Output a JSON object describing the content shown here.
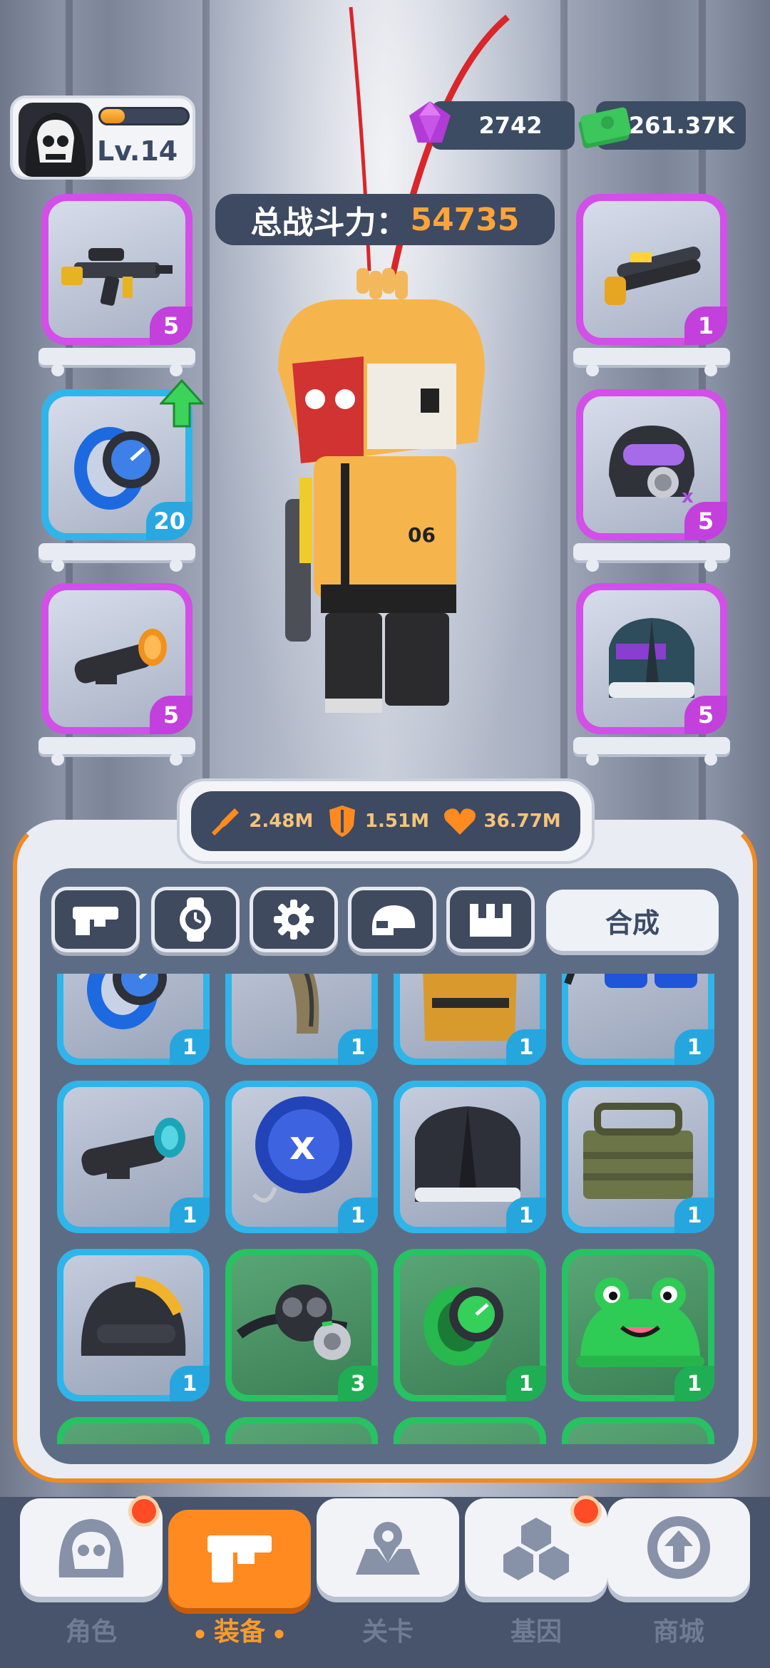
{
  "player": {
    "level_label": "Lv.14",
    "xp_fraction": 0.28,
    "avatar_icon": "skull-hood-icon"
  },
  "currency": {
    "gems": "2742",
    "cash": "261.37K"
  },
  "power": {
    "label": "总战斗力：",
    "value": "54735"
  },
  "equipped": {
    "left": [
      {
        "name": "rifle",
        "icon": "rifle-icon",
        "rarity": "purple",
        "count": "5"
      },
      {
        "name": "watch",
        "icon": "watch-icon",
        "rarity": "blue",
        "count": "20"
      },
      {
        "name": "scope",
        "icon": "scope-icon",
        "rarity": "purple",
        "count": "5"
      }
    ],
    "right": [
      {
        "name": "shotgun",
        "icon": "shotgun-icon",
        "rarity": "purple",
        "count": "1"
      },
      {
        "name": "gas-mask-helmet",
        "icon": "gas-mask-helmet-icon",
        "rarity": "purple",
        "count": "5"
      },
      {
        "name": "suit-jacket",
        "icon": "suit-jacket-icon",
        "rarity": "purple",
        "count": "5"
      }
    ]
  },
  "stats": {
    "attack": "2.48M",
    "defense": "1.51M",
    "health": "36.77M"
  },
  "tabs": {
    "items": [
      "weapon-tab-icon",
      "watch-tab-icon",
      "gear-tab-icon",
      "helmet-tab-icon",
      "armor-tab-icon"
    ],
    "synthesize_label": "合成"
  },
  "inventory": [
    {
      "icon": "watch-icon",
      "rarity": "blue",
      "count": "1"
    },
    {
      "icon": "magazine-icon",
      "rarity": "blue",
      "count": "1"
    },
    {
      "icon": "vest-icon",
      "rarity": "blue",
      "count": "1"
    },
    {
      "icon": "sunglasses-icon",
      "rarity": "blue",
      "count": "1"
    },
    {
      "icon": "scope-icon",
      "rarity": "blue",
      "count": "1"
    },
    {
      "icon": "shield-umbrella-icon",
      "rarity": "blue",
      "count": "1"
    },
    {
      "icon": "jacket-icon",
      "rarity": "blue",
      "count": "1"
    },
    {
      "icon": "ammo-box-icon",
      "rarity": "blue",
      "count": "1"
    },
    {
      "icon": "helmet-icon",
      "rarity": "blue",
      "count": "1"
    },
    {
      "icon": "gas-mask-icon",
      "rarity": "green",
      "count": "3"
    },
    {
      "icon": "green-watch-icon",
      "rarity": "green",
      "count": "1"
    },
    {
      "icon": "frog-hat-icon",
      "rarity": "green",
      "count": "1"
    }
  ],
  "nav": {
    "items": [
      {
        "label": "角色",
        "icon": "character-icon",
        "badge": true
      },
      {
        "label": "装备",
        "icon": "equipment-icon",
        "active": true
      },
      {
        "label": "关卡",
        "icon": "map-pin-icon"
      },
      {
        "label": "基因",
        "icon": "gene-icon",
        "badge": true
      },
      {
        "label": "商城",
        "icon": "shop-icon"
      }
    ]
  },
  "colors": {
    "purple_rarity": "#d24fe8",
    "blue_rarity": "#2fb5ea",
    "green_rarity": "#27c262",
    "accent_orange": "#ff8a1f"
  }
}
